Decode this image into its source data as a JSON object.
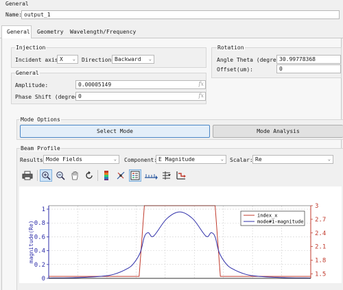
{
  "window": {
    "title": "General"
  },
  "name_field": {
    "label": "Name:",
    "value": "output_1"
  },
  "tabs": [
    {
      "label": "General"
    },
    {
      "label": "Geometry"
    },
    {
      "label": "Wavelength/Frequency"
    }
  ],
  "injection": {
    "title": "Injection",
    "incident_axis_label": "Incident axis:",
    "incident_axis_value": "X",
    "direction_label": "Direction:",
    "direction_value": "Backward"
  },
  "rotation": {
    "title": "Rotation",
    "angle_label": "Angle Theta (degree):",
    "angle_value": "30.99778368",
    "offset_label": "Offset(um):",
    "offset_value": "0"
  },
  "general_group": {
    "title": "General",
    "amplitude_label": "Amplitude:",
    "amplitude_value": "0.00005149",
    "phase_label": "Phase Shift (degree):",
    "phase_value": "0",
    "fx_symbol": "fx"
  },
  "mode_options": {
    "title": "Mode Options",
    "select_mode_label": "Select Mode",
    "mode_analysis_label": "Mode Analysis"
  },
  "beam_profile": {
    "title": "Beam Profile",
    "results_label": "Results:",
    "results_value": "Mode Fields",
    "component_label": "Component:",
    "component_value": "E Magnitude",
    "scalar_label": "Scalar:",
    "scalar_value": "Re"
  },
  "toolbar": {
    "icons": [
      "printer-icon",
      "zoom-in-icon",
      "zoom-out-icon",
      "pan-hand-icon",
      "rotate-icon",
      "colorbar-icon",
      "data-cursor-icon",
      "legend-icon",
      "axis-ticks-icon",
      "grid-options-icon",
      "reset-axes-icon"
    ]
  },
  "colors": {
    "index_series": "#c0392b",
    "mode_series": "#2c2ca8",
    "accent": "#7fb0dd"
  },
  "chart_data": {
    "type": "line",
    "ylabel": "magnitude(Re)",
    "ylim": [
      0,
      1.05
    ],
    "ylim_right": [
      1.4,
      3.0
    ],
    "yticks_left": [
      "0",
      "0.2",
      "0.4",
      "0.6",
      "0.8",
      "1"
    ],
    "yticks_right": [
      "1.5",
      "1.8",
      "2.1",
      "2.4",
      "2.7",
      "3"
    ],
    "grid": true,
    "legend_position": "top-right",
    "series": [
      {
        "name": "index_x",
        "axis": "right",
        "color": "#c0392b",
        "x": [
          -1.0,
          -0.31,
          -0.27,
          -0.25,
          0.25,
          0.27,
          0.31,
          1.0
        ],
        "y": [
          1.444,
          1.444,
          3.0,
          3.0,
          3.0,
          3.0,
          1.444,
          1.444
        ]
      },
      {
        "name": "mode#1-magnitude",
        "axis": "left",
        "color": "#2c2ca8",
        "x": [
          -1.0,
          -0.8,
          -0.6,
          -0.5,
          -0.4,
          -0.35,
          -0.3,
          -0.27,
          -0.24,
          -0.2,
          -0.1,
          0,
          0.1,
          0.2,
          0.24,
          0.27,
          0.3,
          0.35,
          0.4,
          0.5,
          0.6,
          0.8,
          1.0
        ],
        "y": [
          0.005,
          0.01,
          0.03,
          0.06,
          0.14,
          0.22,
          0.38,
          0.6,
          0.66,
          0.61,
          0.86,
          0.96,
          0.86,
          0.61,
          0.66,
          0.6,
          0.38,
          0.22,
          0.14,
          0.06,
          0.03,
          0.01,
          0.005
        ]
      }
    ]
  }
}
